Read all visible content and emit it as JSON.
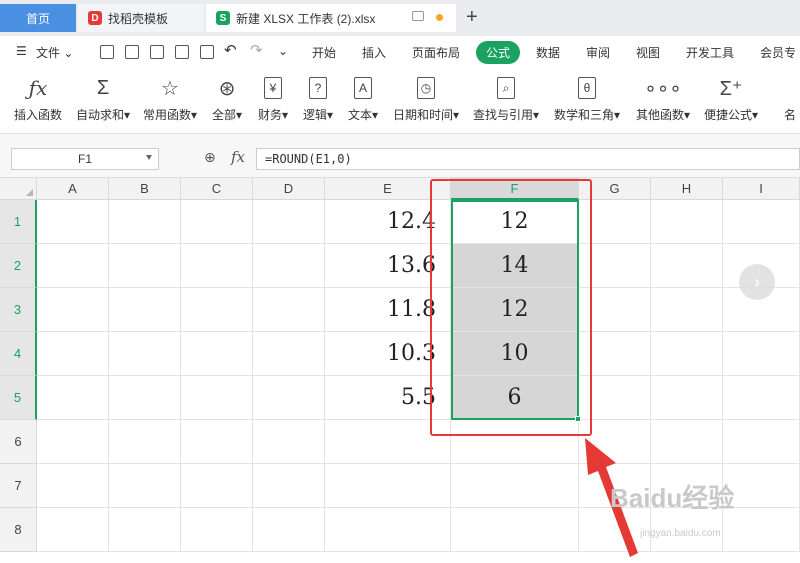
{
  "tabs": {
    "home": "首页",
    "template": "找稻壳模板",
    "file": "新建 XLSX 工作表 (2).xlsx"
  },
  "menu": {
    "file": "文件",
    "items": [
      "开始",
      "插入",
      "页面布局",
      "公式",
      "数据",
      "审阅",
      "视图",
      "开发工具",
      "会员专"
    ],
    "active": "公式"
  },
  "ribbon": [
    {
      "label": "插入函数",
      "icon": "function-icon"
    },
    {
      "label": "自动求和",
      "icon": "sigma-icon"
    },
    {
      "label": "常用函数",
      "icon": "star-icon"
    },
    {
      "label": "全部",
      "icon": "all-icon"
    },
    {
      "label": "财务",
      "icon": "yen-icon"
    },
    {
      "label": "逻辑",
      "icon": "question-icon"
    },
    {
      "label": "文本",
      "icon": "text-icon"
    },
    {
      "label": "日期和时间",
      "icon": "clock-icon"
    },
    {
      "label": "查找与引用",
      "icon": "lookup-icon"
    },
    {
      "label": "数学和三角",
      "icon": "math-icon"
    },
    {
      "label": "其他函数",
      "icon": "more-icon"
    },
    {
      "label": "便捷公式",
      "icon": "quick-formula-icon"
    },
    {
      "label": "名",
      "icon": "name-icon"
    }
  ],
  "formula_bar": {
    "name_box": "F1",
    "fx": "fx",
    "formula": "=ROUND(E1,0)"
  },
  "sheet": {
    "columns": [
      "A",
      "B",
      "C",
      "D",
      "E",
      "F",
      "G",
      "H",
      "I"
    ],
    "rows": [
      "1",
      "2",
      "3",
      "4",
      "5",
      "6",
      "7",
      "8"
    ],
    "col_e": [
      "12.4",
      "13.6",
      "11.8",
      "10.3",
      "5.5"
    ],
    "col_f": [
      "12",
      "14",
      "12",
      "10",
      "6"
    ]
  },
  "watermark": {
    "text": "Baidu经验",
    "sub": "jingyan.baidu.com"
  },
  "colors": {
    "accent": "#1aa260",
    "highlight_box": "#e53935",
    "arrow": "#e53935",
    "home_tab": "#4a90e2"
  }
}
